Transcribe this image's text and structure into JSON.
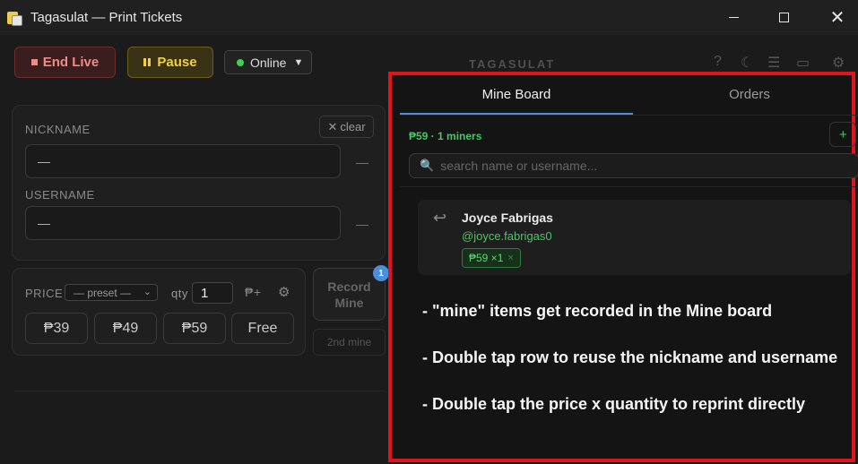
{
  "window": {
    "title": "Tagasulat — Print Tickets"
  },
  "toolbar": {
    "end_live_label": "End Live",
    "pause_label": "Pause",
    "status_label": "Online",
    "brand": "TAGASULAT"
  },
  "identity": {
    "nickname_label": "NICKNAME",
    "nickname_value": "—",
    "username_label": "USERNAME",
    "username_value": "—",
    "clear_label": "clear",
    "side_dash": "—"
  },
  "price": {
    "label": "PRICE",
    "preset_value": "— preset —",
    "qty_label": "qty",
    "qty_value": "1",
    "add_price_label": "₱+",
    "buttons": [
      "₱39",
      "₱49",
      "₱59",
      "Free"
    ]
  },
  "record": {
    "line1": "Record",
    "line2": "Mine",
    "badge": "1",
    "second_label": "2nd mine"
  },
  "mine_board": {
    "tabs": [
      "Mine Board",
      "Orders"
    ],
    "summary": "₱59 · 1 miners",
    "add_label": "+",
    "search_placeholder": "search name or username...",
    "entries": [
      {
        "name": "Joyce Fabrigas",
        "username": "@joyce.fabrigas0",
        "chip": "₱59 ×1",
        "chip_remove": "×"
      }
    ],
    "notes": [
      "- \"mine\" items get recorded in the Mine board",
      "- Double tap row to reuse the nickname and username",
      "- Double tap the price x quantity to reprint directly"
    ]
  },
  "colors": {
    "accent": "#4b8fd6",
    "success": "#46c860",
    "danger": "#f08a8a",
    "warning": "#f4d03f",
    "highlight_border": "#e0141e"
  }
}
